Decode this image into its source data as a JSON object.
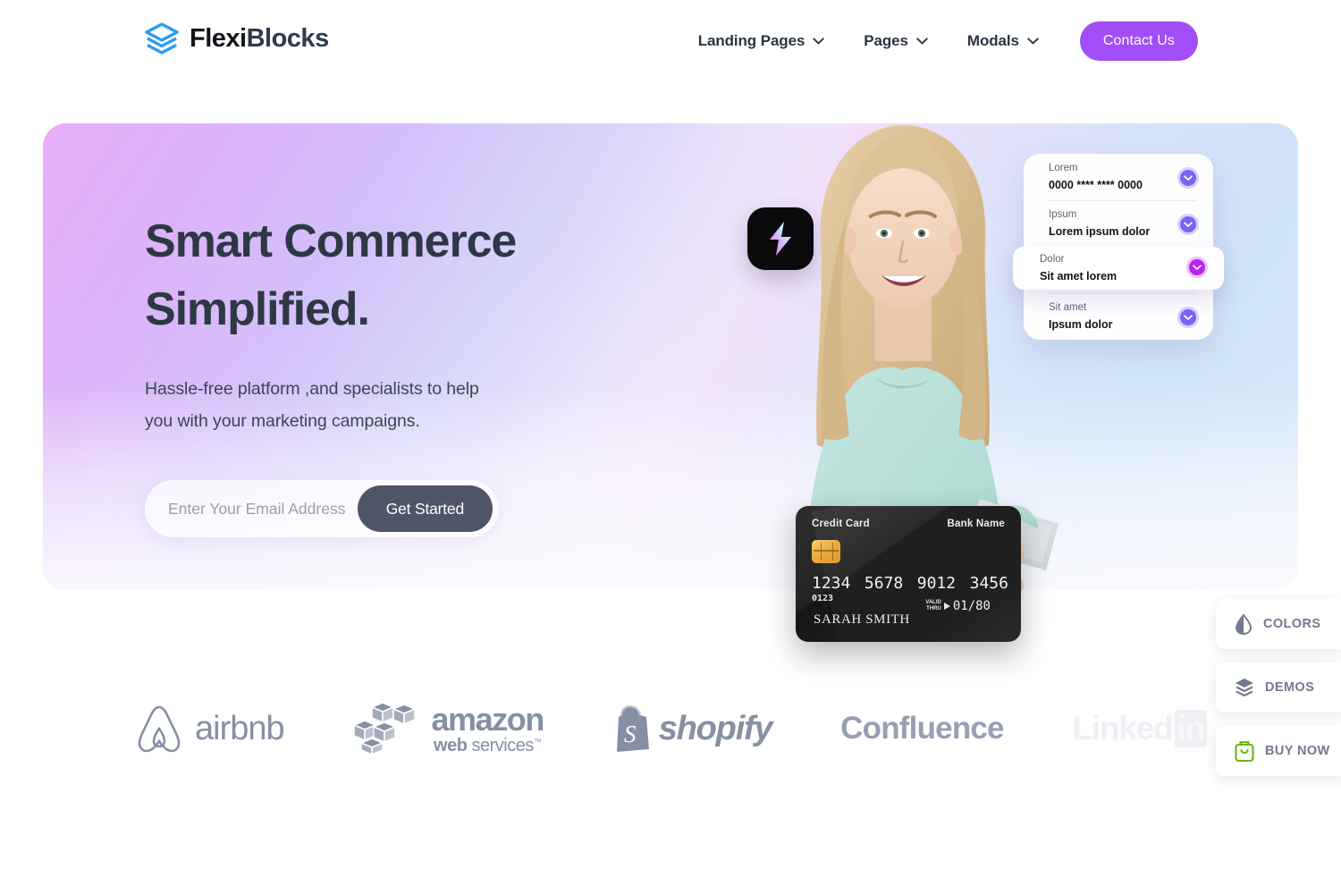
{
  "header": {
    "brand": {
      "name_part1": "Flexi",
      "name_part2": "Blocks",
      "icon": "layers-icon",
      "color": "#2f9ced"
    },
    "nav_items": [
      {
        "label": "Landing Pages",
        "icon": "chevron-down-icon"
      },
      {
        "label": "Pages",
        "icon": "chevron-down-icon"
      },
      {
        "label": "Modals",
        "icon": "chevron-down-icon"
      }
    ],
    "cta": {
      "label": "Contact Us",
      "color": "#a14ef6"
    }
  },
  "hero": {
    "headline_line1": "Smart Commerce",
    "headline_line2": "Simplified.",
    "subhead_line1": "Hassle-free platform ,and specialists to help",
    "subhead_line2": "you with your marketing campaigns.",
    "email_placeholder": "Enter Your Email Address",
    "email_value": "",
    "submit_label": "Get Started",
    "bolt_icon": "lightning-bolt-icon",
    "person_alt": "smiling-woman-holding-tablet"
  },
  "list_card": {
    "rows": [
      {
        "label": "Lorem",
        "value": "0000 **** **** 0000",
        "icon": "chevron-down-icon",
        "active": false
      },
      {
        "label": "Ipsum",
        "value": "Lorem ipsum dolor",
        "icon": "chevron-down-icon",
        "active": false
      },
      {
        "label": "Sit amet",
        "value": "Ipsum dolor",
        "icon": "chevron-down-icon",
        "active": false
      }
    ],
    "active_row": {
      "label": "Dolor",
      "value": "Sit amet lorem",
      "icon": "chevron-down-icon",
      "accent": "#b826ee"
    }
  },
  "credit_card": {
    "title": "Credit Card",
    "bank": "Bank Name",
    "number_groups": [
      "1234",
      "5678",
      "9012",
      "3456"
    ],
    "cvv_line": "0123",
    "valid_label_line1": "VALID",
    "valid_label_line2": "THRU",
    "valid_date": "01/80",
    "holder": "SARAH SMITH"
  },
  "logos": [
    {
      "name": "airbnb",
      "text": "airbnb",
      "icon": "airbnb-icon"
    },
    {
      "name": "amazon-web-services",
      "text": "amazon",
      "subtext_a": "web",
      "subtext_b": "services",
      "tm": "™",
      "icon": "aws-cubes-icon"
    },
    {
      "name": "shopify",
      "text": "shopify",
      "icon": "shopify-bag-icon"
    },
    {
      "name": "confluence",
      "text": "Confluence"
    },
    {
      "name": "linkedin",
      "text_a": "Linked",
      "text_b": "in"
    }
  ],
  "widgets": [
    {
      "label": "COLORS",
      "icon": "droplet-icon",
      "color": "#71798c"
    },
    {
      "label": "DEMOS",
      "icon": "layers-icon",
      "color": "#71798c"
    },
    {
      "label": "BUY NOW",
      "icon": "shopping-bag-icon",
      "color": "#6db312"
    }
  ]
}
